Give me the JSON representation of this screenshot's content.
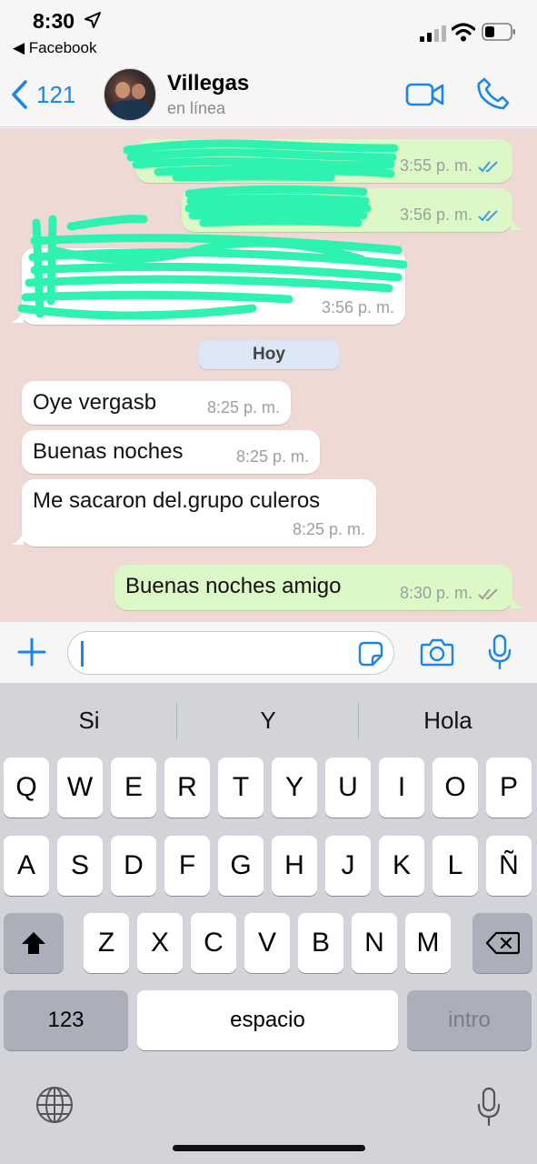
{
  "status": {
    "time": "8:30",
    "back_app": "◀ Facebook"
  },
  "header": {
    "back_count": "121",
    "contact_name": "Villegas",
    "presence": "en línea"
  },
  "messages": [
    {
      "direction": "out",
      "text": "",
      "time": "3:55 p. m.",
      "ticks": "read",
      "redacted": true
    },
    {
      "direction": "out",
      "text": "",
      "time": "3:56 p. m.",
      "ticks": "read",
      "redacted": true
    },
    {
      "direction": "in",
      "text": "",
      "time": "3:56 p. m.",
      "redacted": true
    },
    {
      "direction": "in",
      "text": "Oye vergasb",
      "time": "8:25 p. m."
    },
    {
      "direction": "in",
      "text": "Buenas noches",
      "time": "8:25 p. m."
    },
    {
      "direction": "in",
      "text": "Me sacaron del.grupo culeros",
      "time": "8:25 p. m."
    },
    {
      "direction": "out",
      "text": "Buenas noches amigo",
      "time": "8:30 p. m.",
      "ticks": "delivered"
    }
  ],
  "day_separator": "Hoy",
  "input": {
    "value": "",
    "placeholder": ""
  },
  "keyboard": {
    "suggestions": [
      "Si",
      "Y",
      "Hola"
    ],
    "row1": [
      "Q",
      "W",
      "E",
      "R",
      "T",
      "Y",
      "U",
      "I",
      "O",
      "P"
    ],
    "row2": [
      "A",
      "S",
      "D",
      "F",
      "G",
      "H",
      "J",
      "K",
      "L",
      "Ñ"
    ],
    "row3": [
      "Z",
      "X",
      "C",
      "V",
      "B",
      "N",
      "M"
    ],
    "numbers_key": "123",
    "space_key": "espacio",
    "return_key": "intro"
  },
  "colors": {
    "accent": "#1a86e8",
    "chat_bg": "#efd9d4",
    "outgoing_bubble": "#dcf8c6",
    "incoming_bubble": "#ffffff",
    "read_ticks": "#3b9be8",
    "redaction": "#2ef2b0"
  },
  "icons": [
    "location-arrow-icon",
    "signal-icon",
    "wifi-icon",
    "battery-icon",
    "chevron-left-icon",
    "video-call-icon",
    "phone-icon",
    "plus-icon",
    "sticker-icon",
    "camera-icon",
    "microphone-icon",
    "shift-icon",
    "backspace-icon",
    "globe-icon",
    "dictation-mic-icon"
  ]
}
